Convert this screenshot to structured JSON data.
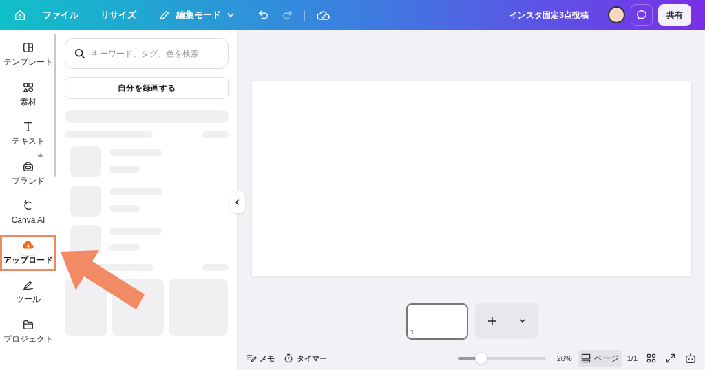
{
  "topbar": {
    "menu": [
      "ファイル",
      "リサイズ"
    ],
    "mode": "編集モード",
    "title": "インスタ固定3点投稿",
    "share": "共有"
  },
  "sidebar": {
    "items": [
      {
        "kind": "template",
        "label": "テンプレート",
        "selected": false
      },
      {
        "kind": "elements",
        "label": "素材",
        "selected": false
      },
      {
        "kind": "text",
        "label": "テキスト",
        "selected": false
      },
      {
        "kind": "brand",
        "label": "ブランド",
        "selected": false
      },
      {
        "kind": "ai",
        "label": "Canva AI",
        "selected": false
      },
      {
        "kind": "upload",
        "label": "アップロード",
        "selected": true
      },
      {
        "kind": "tools",
        "label": "ツール",
        "selected": false
      },
      {
        "kind": "project",
        "label": "プロジェクト",
        "selected": false
      }
    ]
  },
  "panel": {
    "search": {
      "placeholder": "キーワード、タグ、色を検索"
    },
    "record_button": "自分を録画する"
  },
  "pages": [
    {
      "number": "1",
      "selected": true
    }
  ],
  "footer": {
    "memo": "メモ",
    "timer": "タイマー",
    "zoom": {
      "level": 0.27,
      "reading": "26%"
    },
    "page_view": "ページ",
    "page_count": "1/1"
  }
}
